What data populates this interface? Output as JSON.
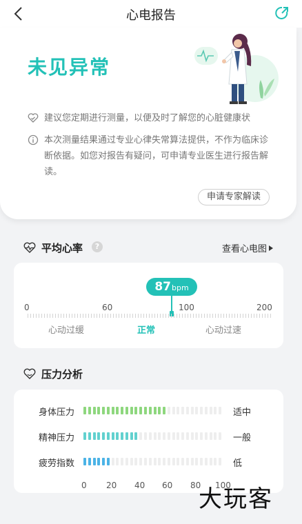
{
  "header": {
    "title": "心电报告",
    "back_icon": "chevron-left-icon",
    "share_icon": "share-icon"
  },
  "result": {
    "status": "未见异常",
    "color": "#23c1b7"
  },
  "notes": [
    {
      "icon": "heart-check-icon",
      "text": "建议您定期进行测量，以便及时了解您的心脏健康状"
    },
    {
      "icon": "info-icon",
      "text": "本次测量结果通过专业心律失常算法提供，不作为临床诊断依据。如您对报告有疑问，可申请专业医生进行报告解读。"
    }
  ],
  "apply_button": "申请专家解读",
  "heart_rate": {
    "title": "平均心率",
    "help": "?",
    "link_label": "查看心电图",
    "value": "87",
    "unit": "bpm",
    "ticks": [
      "0",
      "60",
      "100",
      "200"
    ],
    "zones": [
      "心动过缓",
      "正常",
      "心动过速"
    ],
    "active_zone": "正常"
  },
  "stress": {
    "title": "压力分析",
    "rows": [
      {
        "label": "身体压力",
        "level": "适中",
        "value": 60,
        "color": "#8ed77e"
      },
      {
        "label": "精神压力",
        "level": "一般",
        "value": 40,
        "color": "#62d1cf"
      },
      {
        "label": "疲劳指数",
        "level": "低",
        "value": 20,
        "color": "#4bb3e6"
      }
    ],
    "axis": [
      "0",
      "20",
      "40",
      "60",
      "80",
      "100"
    ]
  },
  "watermark": "大玩客"
}
